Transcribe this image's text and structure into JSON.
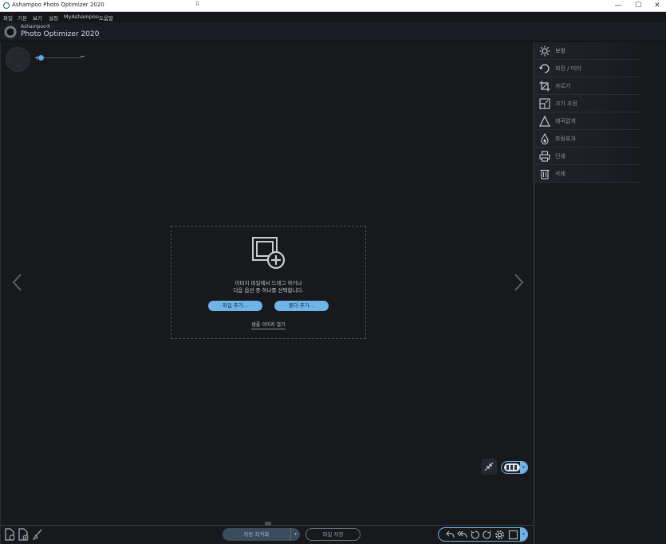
{
  "window": {
    "title": "Ashampoo Photo Optimizer 2020",
    "minimize": "—",
    "maximize": "☐",
    "close": "✕"
  },
  "menu": [
    "파일",
    "기본",
    "보기",
    "설정",
    "MyAshampoo",
    "도움말"
  ],
  "brand": {
    "small": "Ashampoo®",
    "name": "Photo Optimizer 2020"
  },
  "zoom": {
    "plus": "+",
    "minus": "−",
    "level": 0.0
  },
  "dropzone": {
    "line1": "이미지 파일에서 드래그 하거나",
    "line2": "다음 옵션 중 하나를 선택합니다.",
    "add_files": "파일 추가...",
    "add_folder": "폴더 추가...",
    "open_sample": "샘플 이미지 열기"
  },
  "bottom": {
    "auto_optimize": "자동 최적화",
    "auto_dropdown": "▾",
    "save_file": "파일 저장",
    "edit_dropdown": "▾"
  },
  "view_dropdown": "▾",
  "tools": [
    {
      "label": "보정",
      "icon": "sun-icon"
    },
    {
      "label": "회전 / 미러",
      "icon": "rotate-icon"
    },
    {
      "label": "자르기",
      "icon": "crop-icon"
    },
    {
      "label": "크기 조정",
      "icon": "resize-icon"
    },
    {
      "label": "왜곡없게",
      "icon": "triangle-icon"
    },
    {
      "label": "흐림효과",
      "icon": "drop-icon"
    },
    {
      "label": "인쇄",
      "icon": "printer-icon"
    },
    {
      "label": "삭제",
      "icon": "trash-icon"
    }
  ],
  "colors": {
    "accent": "#6fb4e8",
    "background": "#17191d",
    "panel": "#1f2227"
  }
}
